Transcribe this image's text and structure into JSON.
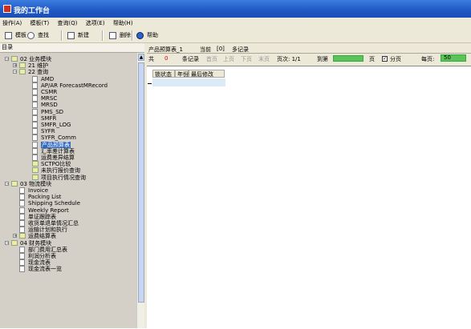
{
  "window": {
    "title": "我的工作台"
  },
  "menu": [
    "操作(A)",
    "模板(T)",
    "查询(Q)",
    "选项(E)",
    "帮助(H)"
  ],
  "toolbar": {
    "template": "模板",
    "find": "查找",
    "new": "新建",
    "delete": "删除",
    "help": "帮助"
  },
  "sidebar": {
    "header": "目录",
    "tree": [
      {
        "label": "02 业务模块",
        "level": 0,
        "type": "folder",
        "expanded": true
      },
      {
        "label": "21 维护",
        "level": 1,
        "type": "folder",
        "expanded": false
      },
      {
        "label": "22 查询",
        "level": 1,
        "type": "folder",
        "expanded": true
      },
      {
        "label": "AMD",
        "level": 2,
        "type": "doc"
      },
      {
        "label": "AP/AR ForecastMRecord",
        "level": 2,
        "type": "doc"
      },
      {
        "label": "CSMR",
        "level": 2,
        "type": "doc"
      },
      {
        "label": "MRSC",
        "level": 2,
        "type": "doc"
      },
      {
        "label": "MRSD",
        "level": 2,
        "type": "doc"
      },
      {
        "label": "PMS_SD",
        "level": 2,
        "type": "doc"
      },
      {
        "label": "SMFR",
        "level": 2,
        "type": "doc"
      },
      {
        "label": "SMFR_LOG",
        "level": 2,
        "type": "doc"
      },
      {
        "label": "SYFR",
        "level": 2,
        "type": "doc"
      },
      {
        "label": "SYFR_Comm",
        "level": 2,
        "type": "doc"
      },
      {
        "label": "产品预算表",
        "level": 2,
        "type": "doc",
        "selected": true
      },
      {
        "label": "汇率差计算表",
        "level": 2,
        "type": "doc"
      },
      {
        "label": "运费差异结算",
        "level": 2,
        "type": "doc"
      },
      {
        "label": "SCTPO比较",
        "level": 2,
        "type": "folder",
        "expanded": false
      },
      {
        "label": "未执行报价查询",
        "level": 2,
        "type": "folder",
        "expanded": false
      },
      {
        "label": "项目执行情况查询",
        "level": 2,
        "type": "folder",
        "expanded": false
      },
      {
        "label": "03 物流模块",
        "level": 0,
        "type": "folder",
        "expanded": true
      },
      {
        "label": "Invoice",
        "level": 1,
        "type": "doc"
      },
      {
        "label": "Packing List",
        "level": 1,
        "type": "doc"
      },
      {
        "label": "Shipping Schedule",
        "level": 1,
        "type": "doc"
      },
      {
        "label": "Weekly Report",
        "level": 1,
        "type": "doc"
      },
      {
        "label": "单证跟踪表",
        "level": 1,
        "type": "doc"
      },
      {
        "label": "收货单退单情况汇总",
        "level": 1,
        "type": "doc"
      },
      {
        "label": "运输计划和执行",
        "level": 1,
        "type": "doc"
      },
      {
        "label": "运费结算表",
        "level": 1,
        "type": "folder",
        "expanded": false
      },
      {
        "label": "04 财务模块",
        "level": 0,
        "type": "folder",
        "expanded": true
      },
      {
        "label": "部门费用汇总表",
        "level": 1,
        "type": "doc"
      },
      {
        "label": "利润分析表",
        "level": 1,
        "type": "doc"
      },
      {
        "label": "现金流表",
        "level": 1,
        "type": "doc"
      },
      {
        "label": "现金流表一览",
        "level": 1,
        "type": "doc"
      }
    ]
  },
  "tab": {
    "name": "产品预算表_1",
    "current_label": "当前",
    "current_count": "[0]",
    "records_label": "多记录"
  },
  "nav": {
    "total_prefix": "共",
    "total_value": "0",
    "total_suffix": "条记录",
    "first": "首页",
    "prev": "上页",
    "next": "下页",
    "last": "末页",
    "page_label": "页次: 1/1",
    "goto_label": "到第",
    "page_unit": "页",
    "paging_label": "分页",
    "paging_checked": true,
    "per_page_label": "每页:",
    "per_page_value": "50"
  },
  "grid": {
    "columns": [
      "锁状态",
      "年份",
      "最后修改"
    ]
  }
}
